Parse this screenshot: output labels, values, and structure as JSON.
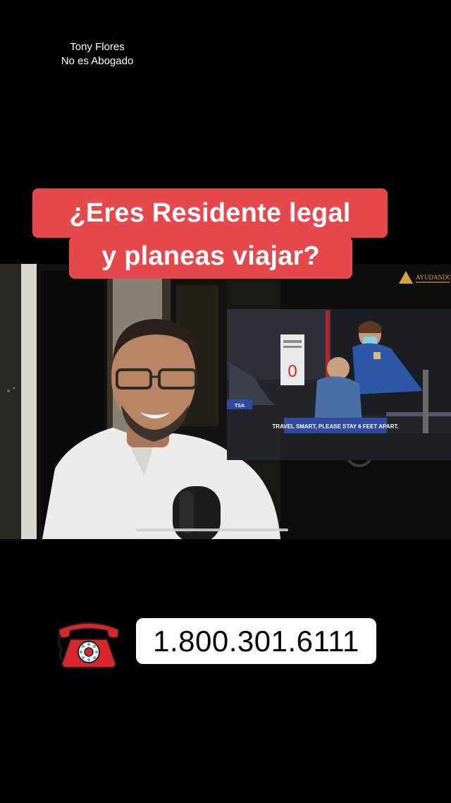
{
  "overlay": {
    "credit_name": "Tony Flores",
    "credit_role": "No es Abogado"
  },
  "caption": {
    "line1": "¿Eres Residente legal",
    "line2": "y planeas viajar?"
  },
  "inset": {
    "logo_text": "AYUDANDO",
    "kiosk_sign_number": "0",
    "barrier_text": "TRAVEL SMART, PLEASE STAY 6 FEET APART.",
    "small_sign_text": "TSA"
  },
  "contact": {
    "phone_number": "1.800.301.6111",
    "phone_icon": "telephone-icon"
  },
  "colors": {
    "caption_bg": "#e7484b",
    "background": "#000000",
    "phone_icon_red": "#d8262c"
  }
}
